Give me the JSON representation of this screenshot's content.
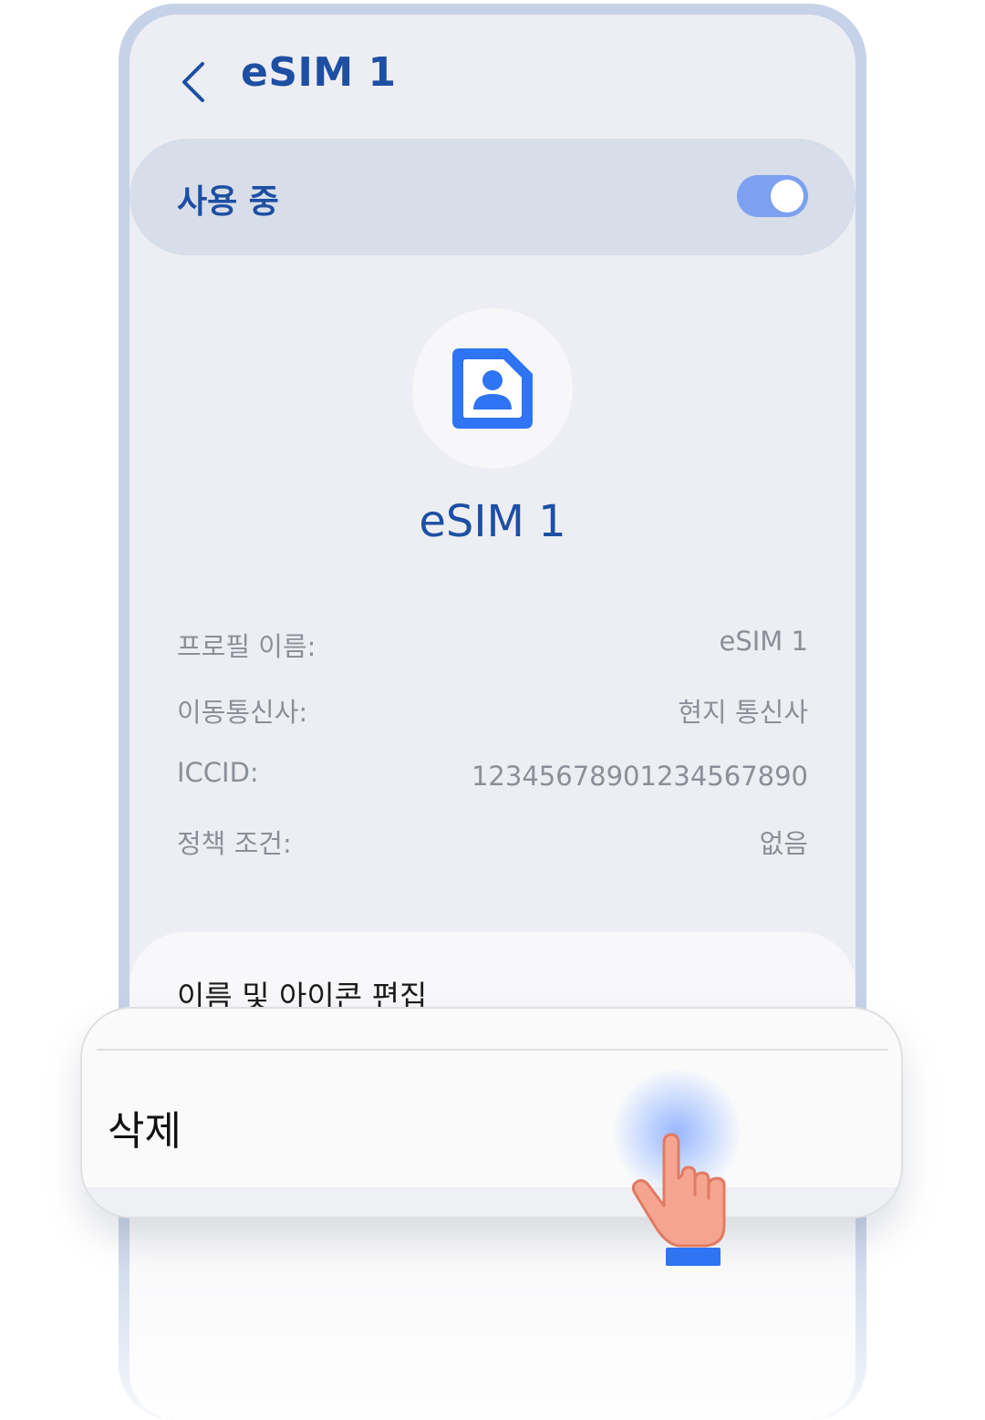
{
  "header": {
    "back_icon": "chevron-left-icon",
    "title": "eSIM 1"
  },
  "status": {
    "label": "사용 중",
    "toggle_on": true
  },
  "profile": {
    "icon": "sim-card-person-icon",
    "title": "eSIM 1"
  },
  "info": [
    {
      "label": "프로필 이름:",
      "value": "eSIM 1"
    },
    {
      "label": "이동통신사:",
      "value": "현지 통신사"
    },
    {
      "label": "ICCID:",
      "value": "12345678901234567890"
    },
    {
      "label": "정책 조건:",
      "value": "없음"
    }
  ],
  "menu": {
    "edit_label": "이름 및 아이콘 편집",
    "delete_label": "삭제"
  },
  "colors": {
    "accent": "#1d4fa3",
    "toggle": "#7da0f0",
    "icon_blue": "#2e74f5",
    "hand_skin": "#f5a48f",
    "cuff": "#2e74f5"
  }
}
